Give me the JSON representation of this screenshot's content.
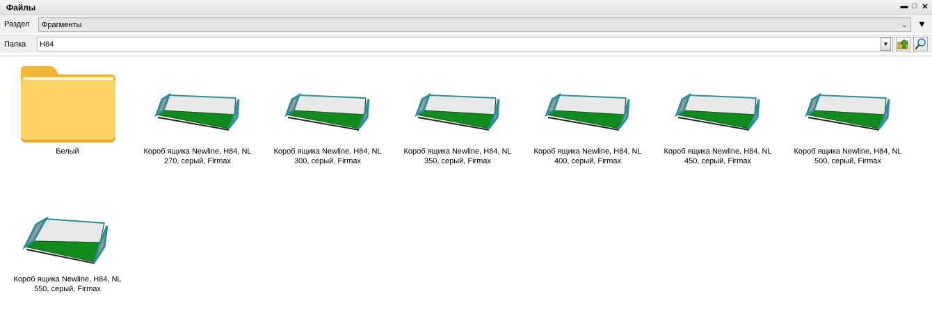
{
  "window": {
    "title": "Файлы",
    "buttons": [
      "▬",
      "□",
      "✕"
    ]
  },
  "section": {
    "label": "Раздел",
    "value": "Фрагменты",
    "menu_glyph": "▼"
  },
  "folder": {
    "label": "Папка",
    "value": "H84"
  },
  "items": [
    {
      "type": "folder",
      "name": "Белый"
    },
    {
      "type": "drawer",
      "name": "Короб ящика Newline, H84, NL 270, серый, Firmax"
    },
    {
      "type": "drawer",
      "name": "Короб ящика Newline, H84, NL 300, серый, Firmax"
    },
    {
      "type": "drawer",
      "name": "Короб ящика Newline, H84, NL 350, серый, Firmax"
    },
    {
      "type": "drawer",
      "name": "Короб ящика Newline, H84, NL 400, серый, Firmax"
    },
    {
      "type": "drawer",
      "name": "Короб ящика Newline, H84, NL 450, серый, Firmax"
    },
    {
      "type": "drawer",
      "name": "Короб ящика Newline, H84, NL 500, серый, Firmax"
    },
    {
      "type": "drawer",
      "name": "Короб ящика Newline, H84, NL 550, серый, Firmax"
    }
  ],
  "colors": {
    "drawer_bottom": "#118a1e",
    "drawer_frame": "#2a8f96",
    "drawer_side": "#9a9a9a",
    "folder_front": "#fcd466",
    "folder_back": "#f2b632"
  }
}
